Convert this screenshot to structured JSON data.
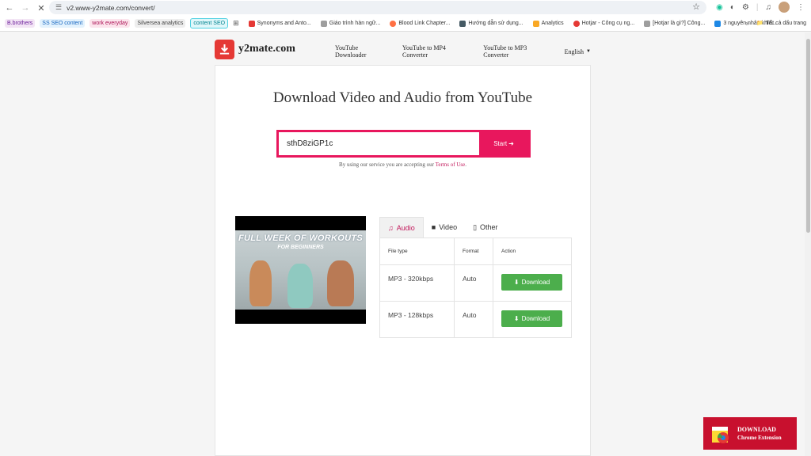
{
  "browser": {
    "url": "v2.www-y2mate.com/convert/",
    "bookmark_chips": [
      {
        "label": "B.brothers",
        "bg": "#f3e5f5",
        "color": "#6a1b9a"
      },
      {
        "label": "SS SEO content",
        "bg": "#e3f2fd",
        "color": "#1565c0"
      },
      {
        "label": "work everyday",
        "bg": "#fce4ec",
        "color": "#ad1457"
      },
      {
        "label": "Silversea analytics",
        "bg": "#eeeeee",
        "color": "#424242"
      },
      {
        "label": "content SEO",
        "bg": "#e0f7fa",
        "color": "#00838f"
      }
    ],
    "bookmarks": [
      {
        "label": "Synonyms and Anto...",
        "color": "#e53935"
      },
      {
        "label": "Giáo trình hàn ngữ...",
        "color": "#9e9e9e"
      },
      {
        "label": "Blood Link Chapter...",
        "color": "#ff7043"
      },
      {
        "label": "Hướng dẫn sử dụng...",
        "color": "#455a64"
      },
      {
        "label": "Analytics",
        "color": "#f9a825"
      },
      {
        "label": "Hotjar - Công cụ ng...",
        "color": "#e53935"
      },
      {
        "label": "[Hotjar là gì?] Công...",
        "color": "#9e9e9e"
      },
      {
        "label": "3 nguyên nhân khiế...",
        "color": "#1e88e5"
      }
    ],
    "all_bookmarks": "Tất cả dấu trang"
  },
  "site": {
    "logo_text": "y2mate.com",
    "nav": [
      "YouTube Downloader",
      "YouTube to MP4 Converter",
      "YouTube to MP3 Converter"
    ],
    "language": "English",
    "hero_title": "Download Video and Audio from YouTube",
    "search_value": "sthD8ziGP1c",
    "start_label": "Start",
    "terms_prefix": "By using our service you are accepting our",
    "terms_link": "Terms of Use",
    "terms_suffix": ".",
    "thumbnail_title": "FULL WEEK OF WORKOUTS",
    "thumbnail_subtitle": "FOR BEGINNERS",
    "tabs": [
      "Audio",
      "Video",
      "Other"
    ],
    "table_headers": [
      "File type",
      "Format",
      "Action"
    ],
    "rows": [
      {
        "file_type": "MP3 - 320kbps",
        "format": "Auto",
        "action": "Download"
      },
      {
        "file_type": "MP3 - 128kbps",
        "format": "Auto",
        "action": "Download"
      }
    ],
    "extension_line1": "DOWNLOAD",
    "extension_line2": "Chrome Extension"
  },
  "colors": {
    "accent": "#e8175d",
    "download_green": "#4cae4c",
    "logo_red": "#e53935",
    "banner_red": "#c8102e"
  }
}
